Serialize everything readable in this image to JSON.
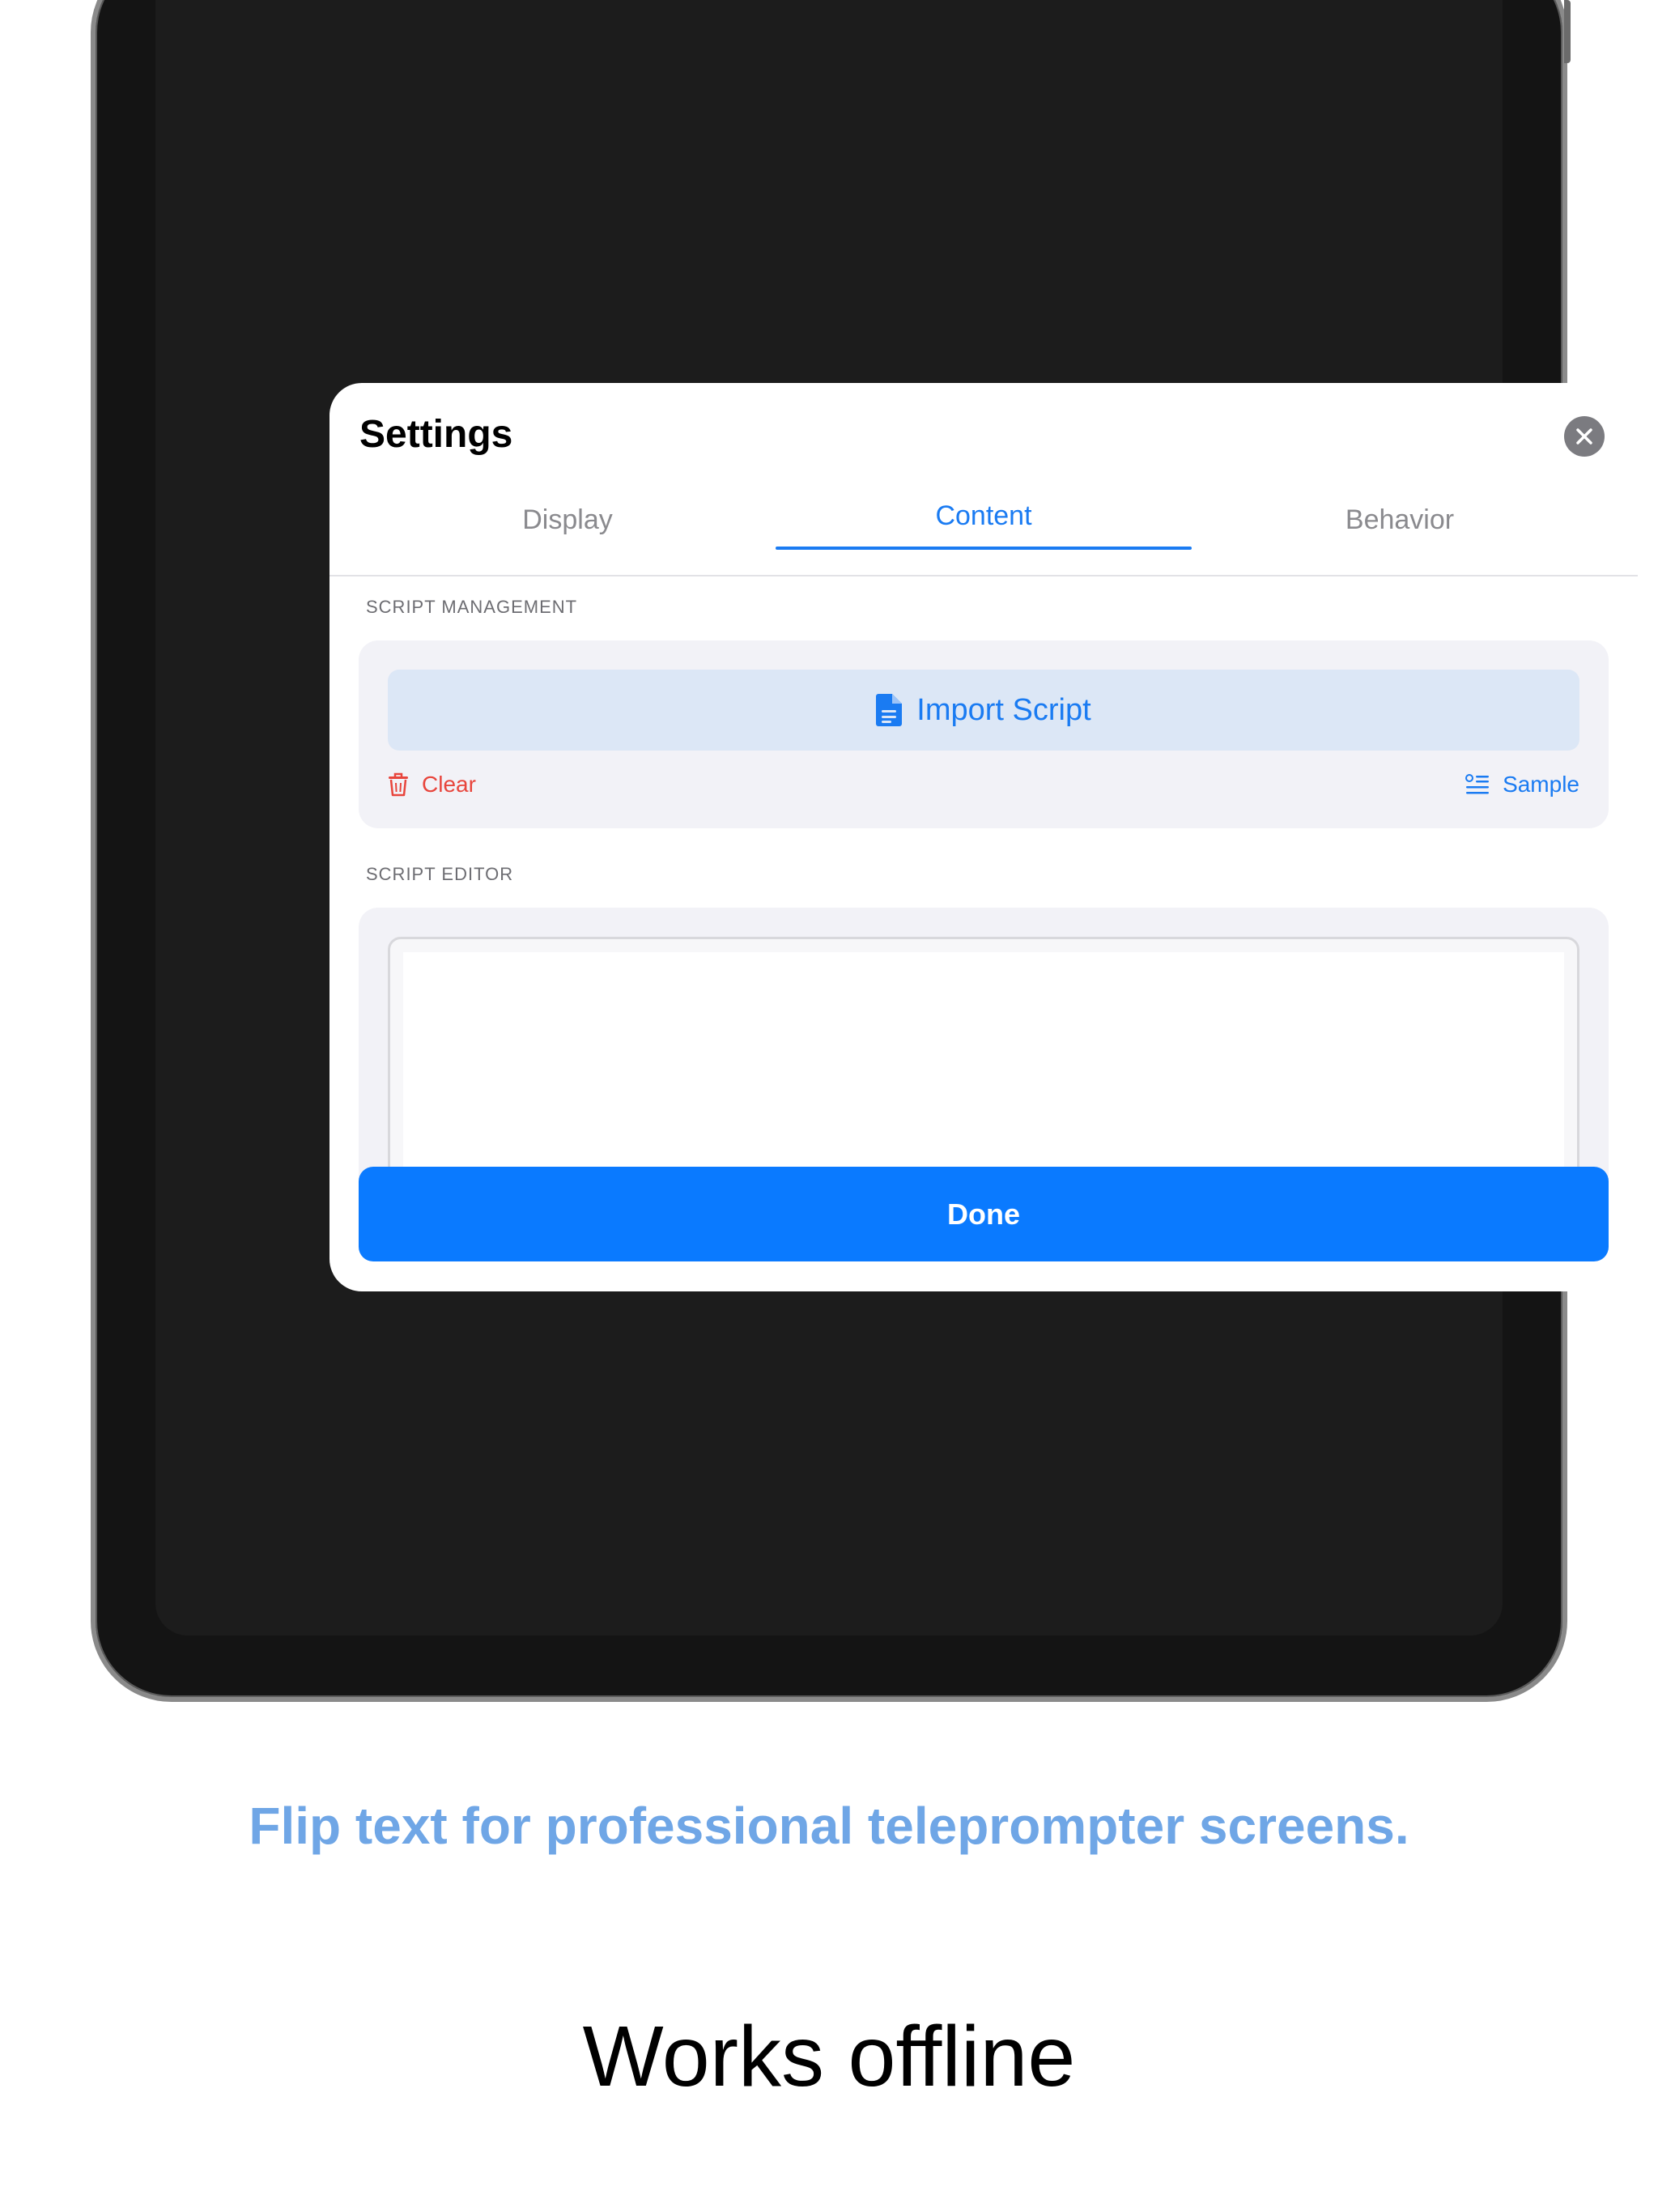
{
  "settings": {
    "title": "Settings",
    "tabs": [
      {
        "label": "Display",
        "active": false
      },
      {
        "label": "Content",
        "active": true
      },
      {
        "label": "Behavior",
        "active": false
      }
    ],
    "script_management": {
      "section_label": "SCRIPT MANAGEMENT",
      "import_label": "Import Script",
      "clear_label": "Clear",
      "sample_label": "Sample"
    },
    "script_editor": {
      "section_label": "SCRIPT EDITOR",
      "value": ""
    },
    "done_label": "Done"
  },
  "marketing": {
    "caption": "Flip text for professional teleprompter screens.",
    "headline": "Works offline"
  },
  "colors": {
    "accent": "#0a7aff",
    "destructive": "#e8453c",
    "caption": "#6fa6e6"
  },
  "icons": {
    "close": "close-icon",
    "import": "document-icon",
    "clear": "trash-icon",
    "sample": "list-icon"
  }
}
